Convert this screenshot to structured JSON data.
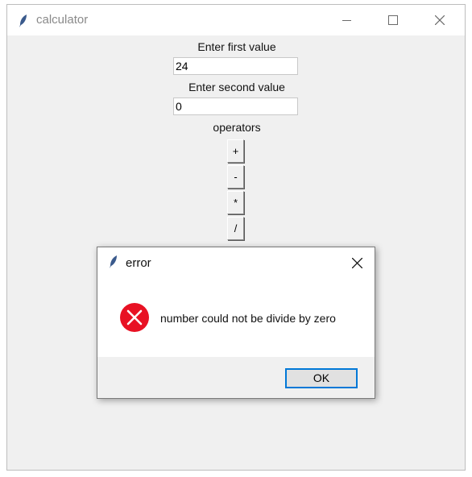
{
  "window": {
    "title": "calculator"
  },
  "form": {
    "first_label": "Enter first value",
    "first_value": "24",
    "second_label": "Enter second value",
    "second_value": "0",
    "operators_label": "operators",
    "operators": [
      "+",
      "-",
      "*",
      "/"
    ]
  },
  "dialog": {
    "title": "error",
    "message": "number could not be divide by zero",
    "ok_label": "OK"
  },
  "colors": {
    "accent": "#0078d7",
    "error": "#e81123"
  },
  "icons": [
    "feather-icon",
    "minimize-icon",
    "maximize-icon",
    "close-icon",
    "error-icon"
  ]
}
